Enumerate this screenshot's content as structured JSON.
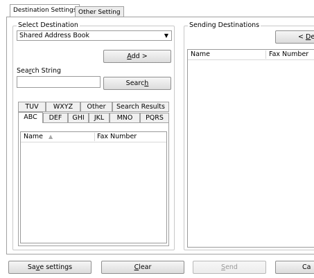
{
  "tabs": [
    {
      "label": "Destination Settings",
      "active": true
    },
    {
      "label": "Other Setting",
      "active": false
    }
  ],
  "select_destination": {
    "legend": "Select Destination",
    "address_book": {
      "selected": "Shared Address Book"
    },
    "add_button": {
      "pre": "",
      "key": "A",
      "post": "dd >"
    },
    "search_label": {
      "pre": "Sea",
      "key": "r",
      "post": "ch String"
    },
    "search_input": {
      "value": "",
      "placeholder": ""
    },
    "search_button": {
      "pre": "Searc",
      "key": "h",
      "post": ""
    },
    "index_tabs_row1": [
      "TUV",
      "WXYZ",
      "Other",
      "Search Results"
    ],
    "index_tabs_row2": [
      "ABC",
      "DEF",
      "GHI",
      "JKL",
      "MNO",
      "PQRS"
    ],
    "active_index_tab": "ABC",
    "list_columns": [
      "Name",
      "Fax Number"
    ]
  },
  "sending_destinations": {
    "legend": "Sending Destinations",
    "delete_button": {
      "pre": "< ",
      "key": "D",
      "post": "ele"
    },
    "list_columns": [
      "Name",
      "Fax Number"
    ]
  },
  "footer": {
    "save_button": {
      "pre": "Sa",
      "key": "v",
      "post": "e settings"
    },
    "clear_button": {
      "pre": "",
      "key": "C",
      "post": "lear"
    },
    "send_button": {
      "pre": "",
      "key": "S",
      "post": "end",
      "disabled": true
    },
    "cancel_button": {
      "pre": "Ca",
      "key": "",
      "post": ""
    }
  }
}
